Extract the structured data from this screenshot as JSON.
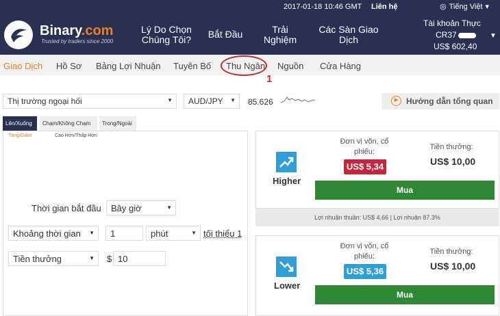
{
  "topbar": {
    "datetime": "2017-01-18 10:46 GMT",
    "contact": "Liên hệ",
    "language": "Tiếng Việt"
  },
  "header": {
    "logo": {
      "name": "Binary",
      "suffix": ".com",
      "tagline": "Trusted by traders since 2000"
    },
    "nav": [
      "Lý Do Chọn Chúng Tôi?",
      "Bắt Đầu",
      "Trải Nghiệm",
      "Các Sàn Giao Dịch"
    ],
    "account": {
      "title": "Tài khoản Thực",
      "id": "CR37",
      "balance": "US$ 602,40"
    }
  },
  "subnav": [
    "Giao Dịch",
    "Hồ Sơ",
    "Bảng Lợi Nhuận",
    "Tuyên Bố",
    "Thu Ngân",
    "Nguồn",
    "Cửa Hàng"
  ],
  "annotation": "1",
  "market": {
    "market": "Thị trường ngoại hối",
    "symbol": "AUD/JPY",
    "price": "85.626",
    "guide": "Hướng dẫn tổng quan"
  },
  "tabs": [
    "Lên/Xuống",
    "Chạm/Không Chạm",
    "Trong/Ngoài"
  ],
  "subtabs": [
    "Tăng/Giảm",
    "Cao Hơn/Thấp Hơn"
  ],
  "form": {
    "start_label": "Thời gian bắt đầu",
    "start_value": "Bây giờ",
    "duration_type": "Khoảng thời gian",
    "duration_value": "1",
    "duration_unit": "phút",
    "min_note": "tối thiểu 1",
    "payout_type": "Tiền thưởng",
    "currency": "$",
    "amount": "10"
  },
  "higher": {
    "label": "Higher",
    "stake_label": "Đơn vị vốn, cổ phiếu:",
    "stake": "US$ 5,34",
    "payout_label": "Tiền thưởng:",
    "payout": "US$ 10,00",
    "buy": "Mua",
    "profit": "Lợi nhuận thuần: US$ 4,66 | Lợi nhuận 87.3%"
  },
  "lower": {
    "label": "Lower",
    "stake_label": "Đơn vị vốn, cổ phiếu:",
    "stake": "US$ 5,36",
    "payout_label": "Tiền thưởng:",
    "payout": "US$ 10,00",
    "buy": "Mua"
  },
  "colors": {
    "brand": "#2a3052",
    "accent": "#e98024",
    "buy": "#2e8836",
    "stake_up": "#c9253a",
    "stake_down": "#2f9fd8",
    "annotation": "#c92a2a"
  }
}
